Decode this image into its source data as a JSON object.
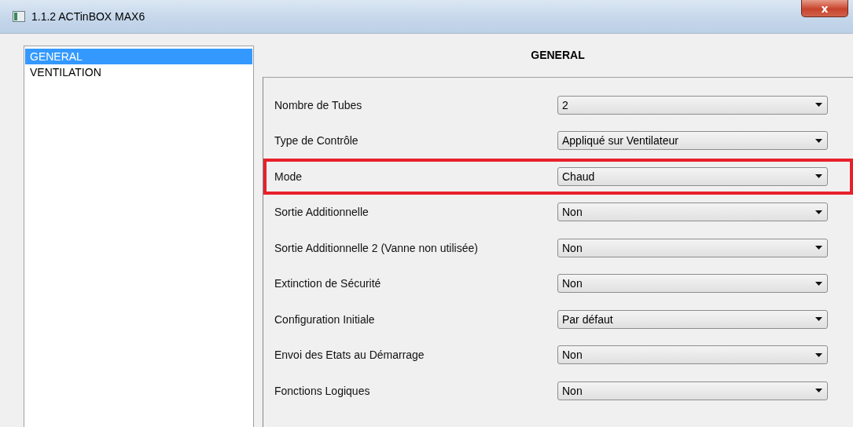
{
  "window": {
    "title": "1.1.2 ACTinBOX MAX6",
    "close": "x"
  },
  "sidebar": {
    "items": [
      {
        "label": "GENERAL",
        "selected": true
      },
      {
        "label": "VENTILATION",
        "selected": false
      }
    ]
  },
  "panel": {
    "title": "GENERAL",
    "rows": [
      {
        "label": "Nombre de Tubes",
        "value": "2",
        "highlighted": false
      },
      {
        "label": "Type de Contrôle",
        "value": "Appliqué sur Ventilateur",
        "highlighted": false
      },
      {
        "label": "Mode",
        "value": "Chaud",
        "highlighted": true
      },
      {
        "label": "Sortie Additionnelle",
        "value": "Non",
        "highlighted": false
      },
      {
        "label": "Sortie Additionnelle 2 (Vanne non utilisée)",
        "value": "Non",
        "highlighted": false
      },
      {
        "label": "Extinction de Sécurité",
        "value": "Non",
        "highlighted": false
      },
      {
        "label": "Configuration Initiale",
        "value": "Par défaut",
        "highlighted": false
      },
      {
        "label": "Envoi des Etats au Démarrage",
        "value": "Non",
        "highlighted": false
      },
      {
        "label": "Fonctions Logiques",
        "value": "Non",
        "highlighted": false
      }
    ]
  }
}
